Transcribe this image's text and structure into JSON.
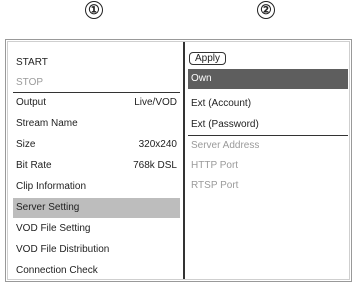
{
  "callouts": {
    "left": "①",
    "right": "②"
  },
  "menu": {
    "start": "START",
    "stop": "STOP",
    "output": {
      "label": "Output",
      "value": "Live/VOD"
    },
    "stream_name": "Stream Name",
    "size": {
      "label": "Size",
      "value": "320x240"
    },
    "bit_rate": {
      "label": "Bit Rate",
      "value": "768k DSL"
    },
    "clip_information": "Clip Information",
    "server_setting": "Server Setting",
    "vod_file_setting": "VOD File Setting",
    "vod_file_distribution": "VOD File Distribution",
    "connection_check": "Connection Check"
  },
  "submenu": {
    "apply": "Apply",
    "own": "Own",
    "ext_account": "Ext (Account)",
    "ext_password": "Ext (Password)",
    "server_address": "Server Address",
    "http_port": "HTTP Port",
    "rtsp_port": "RTSP Port"
  },
  "colors": {
    "selected_bg": "#bdbdbd",
    "active_bg": "#5e5e5e",
    "disabled_text": "#9a9a9a"
  }
}
